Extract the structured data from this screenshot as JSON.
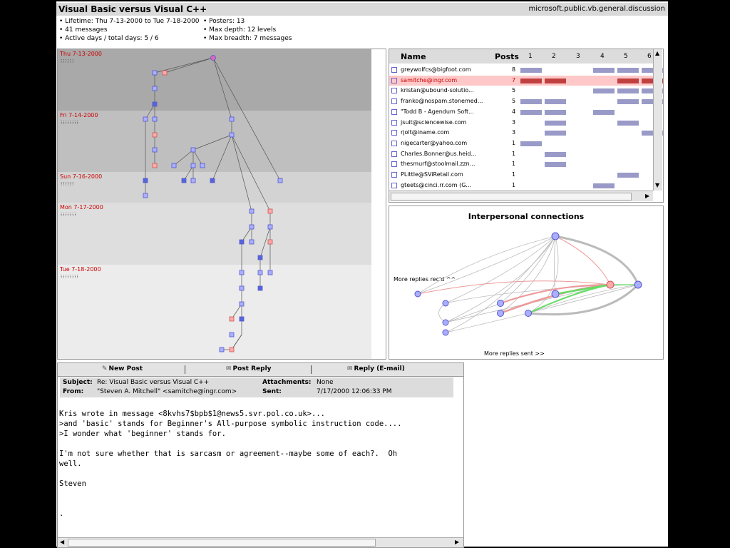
{
  "app": {
    "title": "Visual Basic versus Visual C++",
    "group": "microsoft.public.vb.general.discussion"
  },
  "stats": {
    "left": [
      "• Lifetime: Thu 7-13-2000 to Tue 7-18-2000",
      "• 41 messages",
      "• Active days / total days: 5 / 6"
    ],
    "right": [
      "• Posters: 13",
      "• Max depth: 12 levels",
      "• Max breadth: 7 messages"
    ]
  },
  "tree": {
    "days": [
      {
        "label": "Thu 7-13-2000",
        "people": "⁝⁝⁝⁝⁝⁝"
      },
      {
        "label": "Fri 7-14-2000",
        "people": "⁝⁝⁝⁝⁝⁝⁝⁝"
      },
      {
        "label": "Sun 7-16-2000",
        "people": "⁝⁝⁝⁝⁝⁝"
      },
      {
        "label": "Mon 7-17-2000",
        "people": "⁝⁝⁝⁝⁝⁝⁝"
      },
      {
        "label": "Tue 7-18-2000",
        "people": "⁝⁝⁝⁝⁝⁝⁝⁝"
      }
    ]
  },
  "people": {
    "headers": {
      "name": "Name",
      "posts": "Posts",
      "days": [
        "1",
        "2",
        "3",
        "4",
        "5",
        "6"
      ]
    },
    "rows": [
      {
        "name": "greywolfcs@bigfoot.com",
        "posts": "8",
        "selected": false,
        "bars": [
          1,
          0,
          0,
          1,
          1,
          1
        ]
      },
      {
        "name": "samitche@ingr.com",
        "posts": "7",
        "selected": true,
        "bars": [
          1,
          1,
          0,
          0,
          1,
          1
        ]
      },
      {
        "name": "kristan@ubound-solutio...",
        "posts": "5",
        "selected": false,
        "bars": [
          0,
          0,
          0,
          1,
          1,
          1
        ]
      },
      {
        "name": "franko@nospam.stonemed...",
        "posts": "5",
        "selected": false,
        "bars": [
          1,
          1,
          0,
          0,
          1,
          1
        ]
      },
      {
        "name": "\"Todd B - Agendum Soft...",
        "posts": "4",
        "selected": false,
        "bars": [
          1,
          1,
          0,
          1,
          0,
          0
        ]
      },
      {
        "name": "jsuit@sciencewise.com",
        "posts": "3",
        "selected": false,
        "bars": [
          0,
          1,
          0,
          0,
          1,
          0
        ]
      },
      {
        "name": "rjolt@iname.com",
        "posts": "3",
        "selected": false,
        "bars": [
          0,
          1,
          0,
          0,
          0,
          1
        ]
      },
      {
        "name": "nigecarter@yahoo.com",
        "posts": "1",
        "selected": false,
        "bars": [
          1,
          0,
          0,
          0,
          0,
          0
        ]
      },
      {
        "name": "Charles.Bonner@us.heid...",
        "posts": "1",
        "selected": false,
        "bars": [
          0,
          1,
          0,
          0,
          0,
          0
        ]
      },
      {
        "name": "thesmurf@stoolmail.zzn...",
        "posts": "1",
        "selected": false,
        "bars": [
          0,
          1,
          0,
          0,
          0,
          0
        ]
      },
      {
        "name": "PLittle@SViRetail.com",
        "posts": "1",
        "selected": false,
        "bars": [
          0,
          0,
          0,
          0,
          1,
          0
        ]
      },
      {
        "name": "gteets@cinci.rr.com (G...",
        "posts": "1",
        "selected": false,
        "bars": [
          0,
          0,
          0,
          1,
          0,
          0
        ]
      }
    ]
  },
  "connections": {
    "title": "Interpersonal connections",
    "received_label": "More replies rec'd ^^",
    "sent_label": "More replies sent >>"
  },
  "toolbar": {
    "new_post": "New Post",
    "post_reply": "Post Reply",
    "reply_email": "Reply (E-mail)"
  },
  "message": {
    "subject_label": "Subject:",
    "subject": "Re: Visual Basic versus Visual C++",
    "from_label": "From:",
    "from": "\"Steven A. Mitchell\" <samitche@ingr.com>",
    "attachments_label": "Attachments:",
    "attachments": "None",
    "sent_label": "Sent:",
    "sent": "7/17/2000 12:06:33 PM",
    "body": "Kris wrote in message <8kvhs7$bpb$1@news5.svr.pol.co.uk>...\n>and 'basic' stands for Beginner's All-purpose symbolic instruction code....\n>I wonder what 'beginner' stands for.\n\nI'm not sure whether that is sarcasm or agreement--maybe some of each?.  Oh\nwell.\n\nSteven\n\n\n."
  },
  "colors": {
    "accent_red": "#c04040",
    "bar_blue": "#9a9ac8",
    "node_blue": "#9999ee",
    "node_red": "#ee9999"
  }
}
